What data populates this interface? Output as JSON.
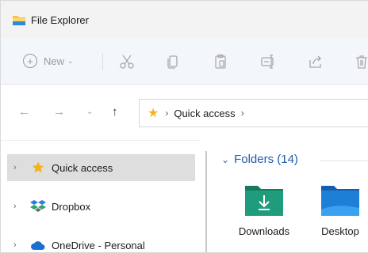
{
  "window": {
    "title": "File Explorer"
  },
  "command_bar": {
    "new_label": "New",
    "icons": [
      "cut-icon",
      "copy-icon",
      "paste-icon",
      "rename-icon",
      "share-icon",
      "delete-icon"
    ]
  },
  "address": {
    "crumbs": [
      "Quick access"
    ],
    "root_icon": "star-icon"
  },
  "sidebar": {
    "items": [
      {
        "label": "Quick access",
        "icon": "star-icon",
        "selected": true
      },
      {
        "label": "Dropbox",
        "icon": "dropbox-icon",
        "selected": false
      },
      {
        "label": "OneDrive - Personal",
        "icon": "cloud-icon",
        "selected": false
      }
    ]
  },
  "content": {
    "group_title": "Folders (14)",
    "folders": [
      {
        "label": "Downloads",
        "icon": "downloads-folder-icon",
        "color": "#1f9c7b"
      },
      {
        "label": "Desktop",
        "icon": "desktop-folder-icon",
        "color": "#1e7fd6"
      }
    ]
  },
  "colors": {
    "accent_blue": "#1f5aa8",
    "star": "#f2b31d",
    "selected_bg": "#dedede",
    "command_bar_bg": "#f3f7fb"
  }
}
